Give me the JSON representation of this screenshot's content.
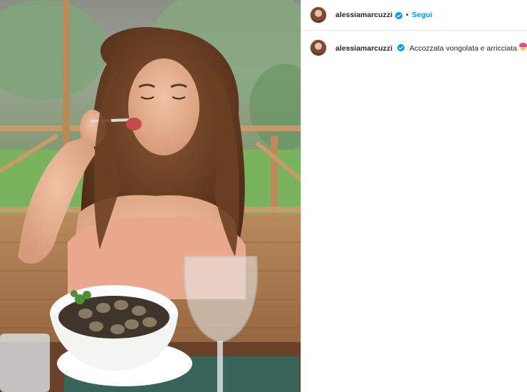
{
  "post": {
    "author": {
      "username": "alessiamarcuzzi",
      "verified": true,
      "verified_icon": "verified-badge-icon",
      "separator": "•",
      "follow_label": "Segui"
    },
    "caption": {
      "username": "alessiamarcuzzi",
      "text": "Accozzata vongolata e arricciata",
      "emoji_icon": "woman-getting-haircut-emoji"
    },
    "colors": {
      "link_blue": "#0095f6",
      "text": "#262626",
      "border": "#dbdbdb"
    }
  }
}
